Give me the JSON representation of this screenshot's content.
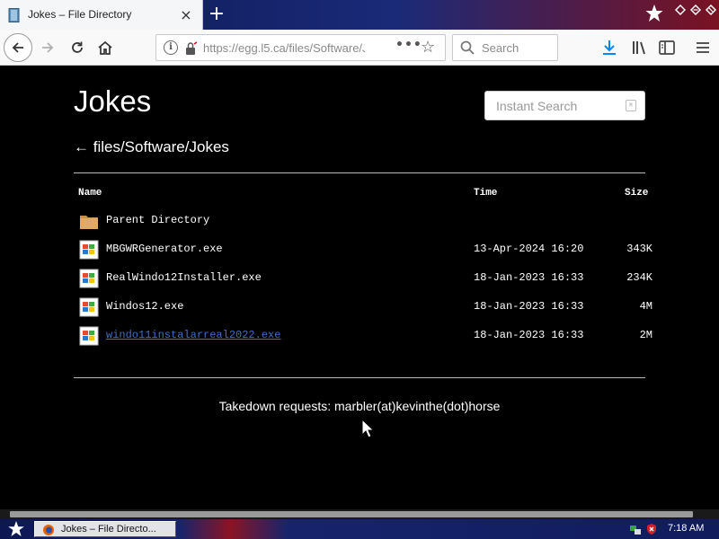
{
  "browser": {
    "tab_title": "Jokes – File Directory",
    "tab_close": "×",
    "new_tab": "+",
    "url": "https://egg.l5.ca/files/Software/Jokes/",
    "search_placeholder": "Search"
  },
  "page": {
    "title": "Jokes",
    "instant_search_placeholder": "Instant Search",
    "breadcrumb": "← files/Software/Jokes",
    "columns": {
      "name": "Name",
      "time": "Time",
      "size": "Size"
    },
    "parent_label": "Parent Directory",
    "files": [
      {
        "name": "MBGWRGenerator.exe",
        "time": "13-Apr-2024 16:20",
        "size": "343K"
      },
      {
        "name": "RealWindo12Installer.exe",
        "time": "18-Jan-2023 16:33",
        "size": "234K"
      },
      {
        "name": "Windos12.exe",
        "time": "18-Jan-2023 16:33",
        "size": "4M"
      },
      {
        "name": "windo11instalarreal2022.exe",
        "time": "18-Jan-2023 16:33",
        "size": "2M"
      }
    ],
    "footer": "Takedown requests: marbler(at)kevinthe(dot)horse"
  },
  "taskbar": {
    "task_label": "Jokes – File Directo...",
    "clock": "7:18 AM"
  },
  "colors": {
    "page_bg": "#000000",
    "link": "#3f6fc8",
    "taskbar": "#101c5c"
  }
}
